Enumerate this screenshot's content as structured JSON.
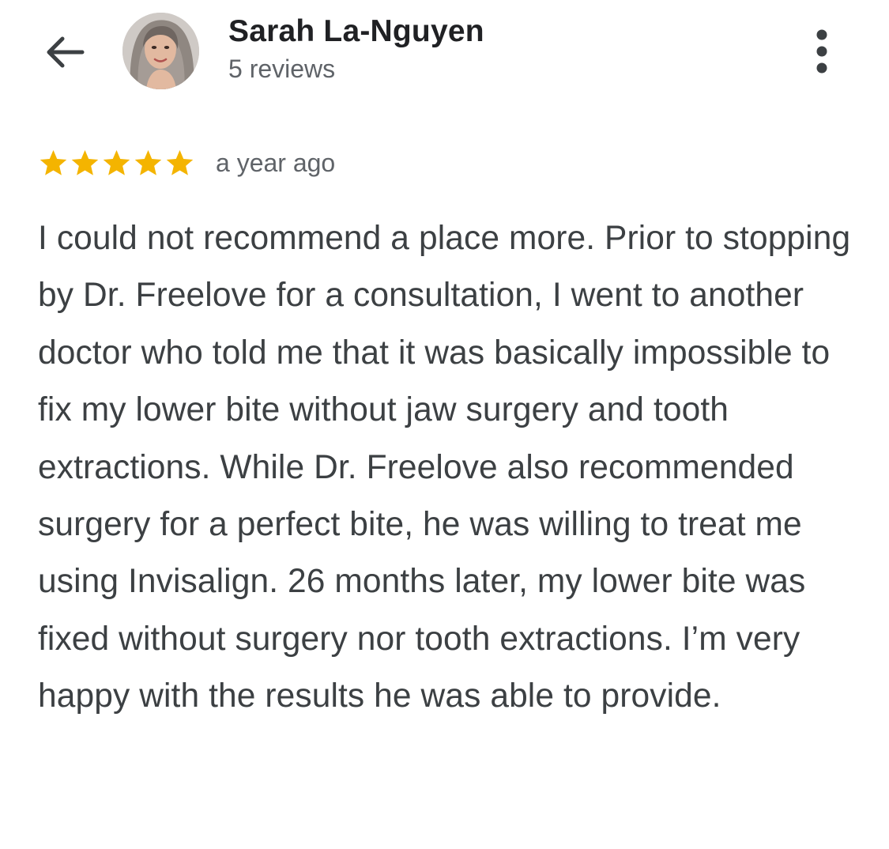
{
  "header": {
    "reviewer_name": "Sarah La-Nguyen",
    "review_count": "5 reviews",
    "back_icon": "arrow-left-icon",
    "more_icon": "more-vert-icon"
  },
  "review": {
    "rating": 5,
    "rating_max": 5,
    "star_color": "#F4B400",
    "date": "a year ago",
    "text": "I could not recommend a place more. Prior to stopping by Dr. Freelove for a consultation, I went to another doctor who told me that it was basically impossible to fix my lower bite without jaw surgery and tooth extractions. While Dr. Freelove also recommended surgery for a perfect bite, he was willing to treat me using Invisalign. 26 months later, my lower bite was fixed without surgery nor tooth extractions. I’m very happy with the results he was able to provide."
  }
}
